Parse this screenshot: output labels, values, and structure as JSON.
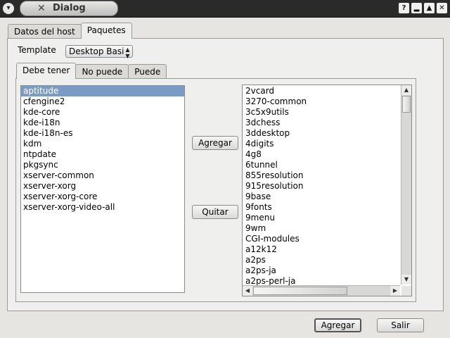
{
  "window": {
    "title": "Dialog",
    "menu_icon": "▾",
    "title_icon": "✕",
    "buttons": [
      "?",
      "▂",
      "▲",
      "✕"
    ]
  },
  "main_tabs": [
    {
      "label": "Datos del host",
      "active": false
    },
    {
      "label": "Paquetes",
      "active": true
    }
  ],
  "template": {
    "label": "Template",
    "selected": "Desktop Basi",
    "arrow": "▲▼"
  },
  "sub_tabs": [
    {
      "label": "Debe tener",
      "active": true
    },
    {
      "label": "No puede",
      "active": false
    },
    {
      "label": "Puede",
      "active": false
    }
  ],
  "selected_packages": [
    "aptitude",
    "cfengine2",
    "kde-core",
    "kde-i18n",
    "kde-i18n-es",
    "kdm",
    "ntpdate",
    "pkgsync",
    "xserver-common",
    "xserver-xorg",
    "xserver-xorg-core",
    "xserver-xorg-video-all"
  ],
  "selected_index": 0,
  "available_packages": [
    "2vcard",
    "3270-common",
    "3c5x9utils",
    "3dchess",
    "3ddesktop",
    "4digits",
    "4g8",
    "6tunnel",
    "855resolution",
    "915resolution",
    "9base",
    "9fonts",
    "9menu",
    "9wm",
    "CGI-modules",
    "a12k12",
    "a2ps",
    "a2ps-ja",
    "a2ps-perl-ja"
  ],
  "middle_buttons": {
    "add": "Agregar",
    "remove": "Quitar"
  },
  "scroll_arrows": {
    "up": "▲",
    "down": "▼",
    "left": "◀",
    "right": "▶"
  },
  "footer": {
    "accept": "Agregar",
    "exit": "Salir"
  },
  "colors": {
    "selection": "#7a9cc4",
    "titlebar": "#2a2a2a"
  }
}
